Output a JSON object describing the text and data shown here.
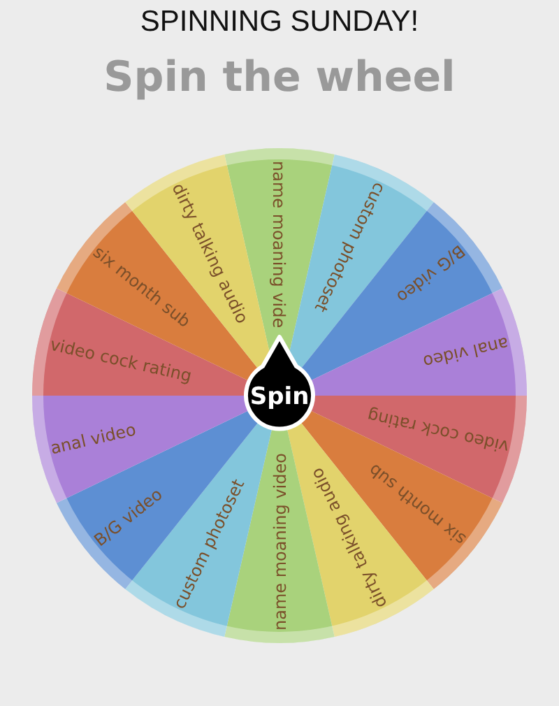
{
  "title": "SPINNING SUNDAY!",
  "heading": "Spin the wheel",
  "wheel": {
    "segments": [
      {
        "label": "name moaning vide",
        "color": "#a9d27c"
      },
      {
        "label": "custom photoset",
        "color": "#83c6dc"
      },
      {
        "label": "B/G video",
        "color": "#5d8fd3"
      },
      {
        "label": "anal video",
        "color": "#aa80d8"
      },
      {
        "label": "video cock rating",
        "color": "#d1686b"
      },
      {
        "label": "six month sub",
        "color": "#d97d3e"
      },
      {
        "label": "dirty talking audio",
        "color": "#e2d36c"
      },
      {
        "label": "name moaning video",
        "color": "#a9d27c"
      },
      {
        "label": "custom photoset",
        "color": "#83c6dc"
      },
      {
        "label": "B/G video",
        "color": "#5d8fd3"
      },
      {
        "label": "anal video",
        "color": "#aa80d8"
      },
      {
        "label": "video cock rating",
        "color": "#d1686b"
      },
      {
        "label": "six month sub",
        "color": "#d97d3e"
      },
      {
        "label": "dirty talking audio",
        "color": "#e2d36c"
      }
    ],
    "spin_button": "Spin"
  }
}
